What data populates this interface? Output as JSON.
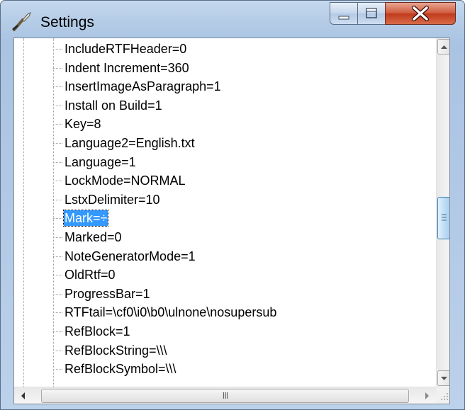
{
  "window": {
    "title": "Settings"
  },
  "icons": {
    "app": "settings-wrench-icon",
    "minimize": "minimize-icon",
    "maximize": "maximize-icon",
    "close": "close-icon"
  },
  "tree": {
    "items": [
      {
        "label": "IncludeRTFHeader=0",
        "selected": false
      },
      {
        "label": "Indent Increment=360",
        "selected": false
      },
      {
        "label": "InsertImageAsParagraph=1",
        "selected": false
      },
      {
        "label": "Install on Build=1",
        "selected": false
      },
      {
        "label": "Key=8",
        "selected": false
      },
      {
        "label": "Language2=English.txt",
        "selected": false
      },
      {
        "label": "Language=1",
        "selected": false
      },
      {
        "label": "LockMode=NORMAL",
        "selected": false
      },
      {
        "label": "LstxDelimiter=10",
        "selected": false
      },
      {
        "label": "Mark=÷",
        "selected": true
      },
      {
        "label": "Marked=0",
        "selected": false
      },
      {
        "label": "NoteGeneratorMode=1",
        "selected": false
      },
      {
        "label": "OldRtf=0",
        "selected": false
      },
      {
        "label": "ProgressBar=1",
        "selected": false
      },
      {
        "label": "RTFtail=\\cf0\\i0\\b0\\ulnone\\nosupersub",
        "selected": false
      },
      {
        "label": "RefBlock=1",
        "selected": false
      },
      {
        "label": "RefBlockString=\\\\\\",
        "selected": false
      },
      {
        "label": "RefBlockSymbol=\\\\\\",
        "selected": false
      }
    ]
  },
  "vscroll": {
    "position_fraction": 0.52
  },
  "hscroll": {
    "thumb_grip": "III"
  },
  "colors": {
    "selection": "#3399ff",
    "close_button": "#c9472a",
    "frame": "#b5cce6"
  }
}
